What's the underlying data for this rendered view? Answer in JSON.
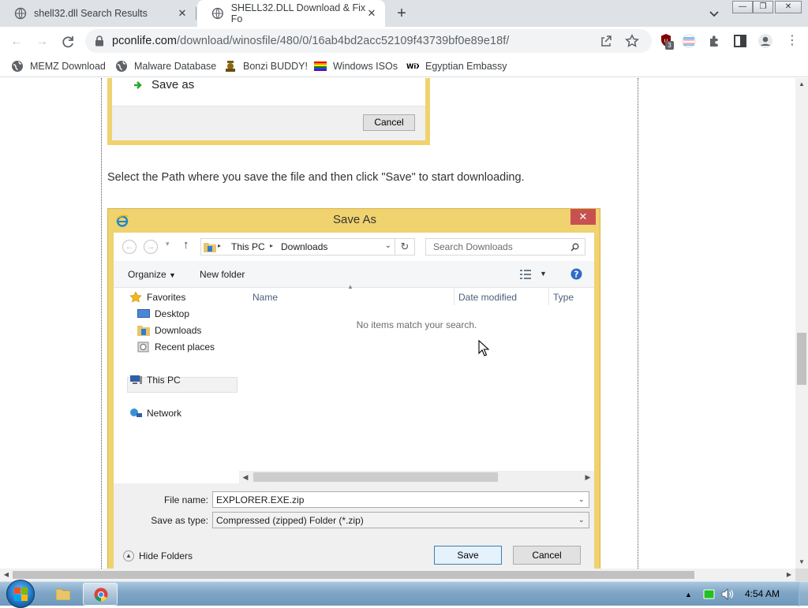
{
  "browser": {
    "tabs": [
      {
        "title": "shell32.dll Search Results",
        "active": false
      },
      {
        "title": "SHELL32.DLL Download & Fix Fo",
        "active": true
      }
    ],
    "address": {
      "host": "pconlife.com",
      "path": "/download/winosfile/480/0/16ab4bd2acc52109f43739bf0e89e18f/"
    },
    "extension_badge": "3",
    "bookmarks": [
      {
        "label": "MEMZ Download",
        "icon": "globe-icon"
      },
      {
        "label": "Malware Database",
        "icon": "globe-icon"
      },
      {
        "label": "Bonzi BUDDY!",
        "icon": "bonzi-icon"
      },
      {
        "label": "Windows ISOs",
        "icon": "windows-flag-icon"
      },
      {
        "label": "Egyptian Embassy",
        "icon": "wix-icon"
      }
    ]
  },
  "page": {
    "first_screenshot": {
      "menu_item": "Save as",
      "cancel": "Cancel"
    },
    "instruction": "Select the Path where you save the file and then click \"Save\" to start downloading.",
    "dialog": {
      "title": "Save As",
      "path": [
        "This PC",
        "Downloads"
      ],
      "search_placeholder": "Search Downloads",
      "organize": "Organize",
      "new_folder": "New folder",
      "nav": {
        "favorites": "Favorites",
        "desktop": "Desktop",
        "downloads": "Downloads",
        "recent": "Recent places",
        "this_pc": "This PC",
        "network": "Network"
      },
      "columns": [
        "Name",
        "Date modified",
        "Type"
      ],
      "empty_message": "No items match your search.",
      "file_name_label": "File name:",
      "file_name": "EXPLORER.EXE.zip",
      "type_label": "Save as type:",
      "type_value": "Compressed (zipped) Folder (*.zip)",
      "hide_folders": "Hide Folders",
      "save": "Save",
      "cancel": "Cancel"
    }
  },
  "taskbar": {
    "time": "4:54 AM"
  },
  "colors": {
    "dialog_frame": "#f0d26f",
    "close_red": "#c75050",
    "tab_strip": "#dee1e6"
  }
}
